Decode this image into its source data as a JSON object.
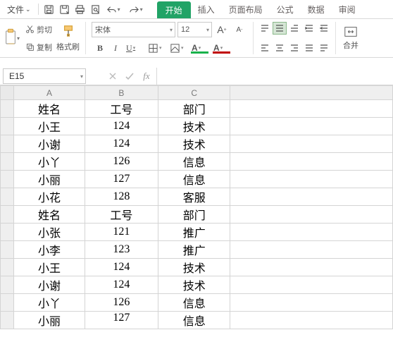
{
  "menu": {
    "file_label": "文件",
    "tabs": [
      "开始",
      "插入",
      "页面布局",
      "公式",
      "数据",
      "审阅"
    ]
  },
  "clipboard": {
    "cut_label": "剪切",
    "copy_label": "复制",
    "painter_label": "格式刷"
  },
  "font": {
    "name": "宋体",
    "size": "12"
  },
  "merge_label": "合并",
  "namebox": {
    "value": "E15"
  },
  "formula": {
    "value": ""
  },
  "columns": [
    "A",
    "B",
    "C"
  ],
  "sheet": {
    "rows": [
      {
        "a": "姓名",
        "b": "工号",
        "c": "部门"
      },
      {
        "a": "小王",
        "b": "124",
        "c": "技术"
      },
      {
        "a": "小谢",
        "b": "124",
        "c": "技术"
      },
      {
        "a": "小丫",
        "b": "126",
        "c": "信息"
      },
      {
        "a": "小丽",
        "b": "127",
        "c": "信息"
      },
      {
        "a": "小花",
        "b": "128",
        "c": "客服"
      },
      {
        "a": "姓名",
        "b": "工号",
        "c": "部门"
      },
      {
        "a": "小张",
        "b": "121",
        "c": "推广"
      },
      {
        "a": "小李",
        "b": "123",
        "c": "推广"
      },
      {
        "a": "小王",
        "b": "124",
        "c": "技术"
      },
      {
        "a": "小谢",
        "b": "124",
        "c": "技术"
      },
      {
        "a": "小丫",
        "b": "126",
        "c": "信息"
      },
      {
        "a": "小丽",
        "b": "127",
        "c": "信息"
      }
    ]
  }
}
